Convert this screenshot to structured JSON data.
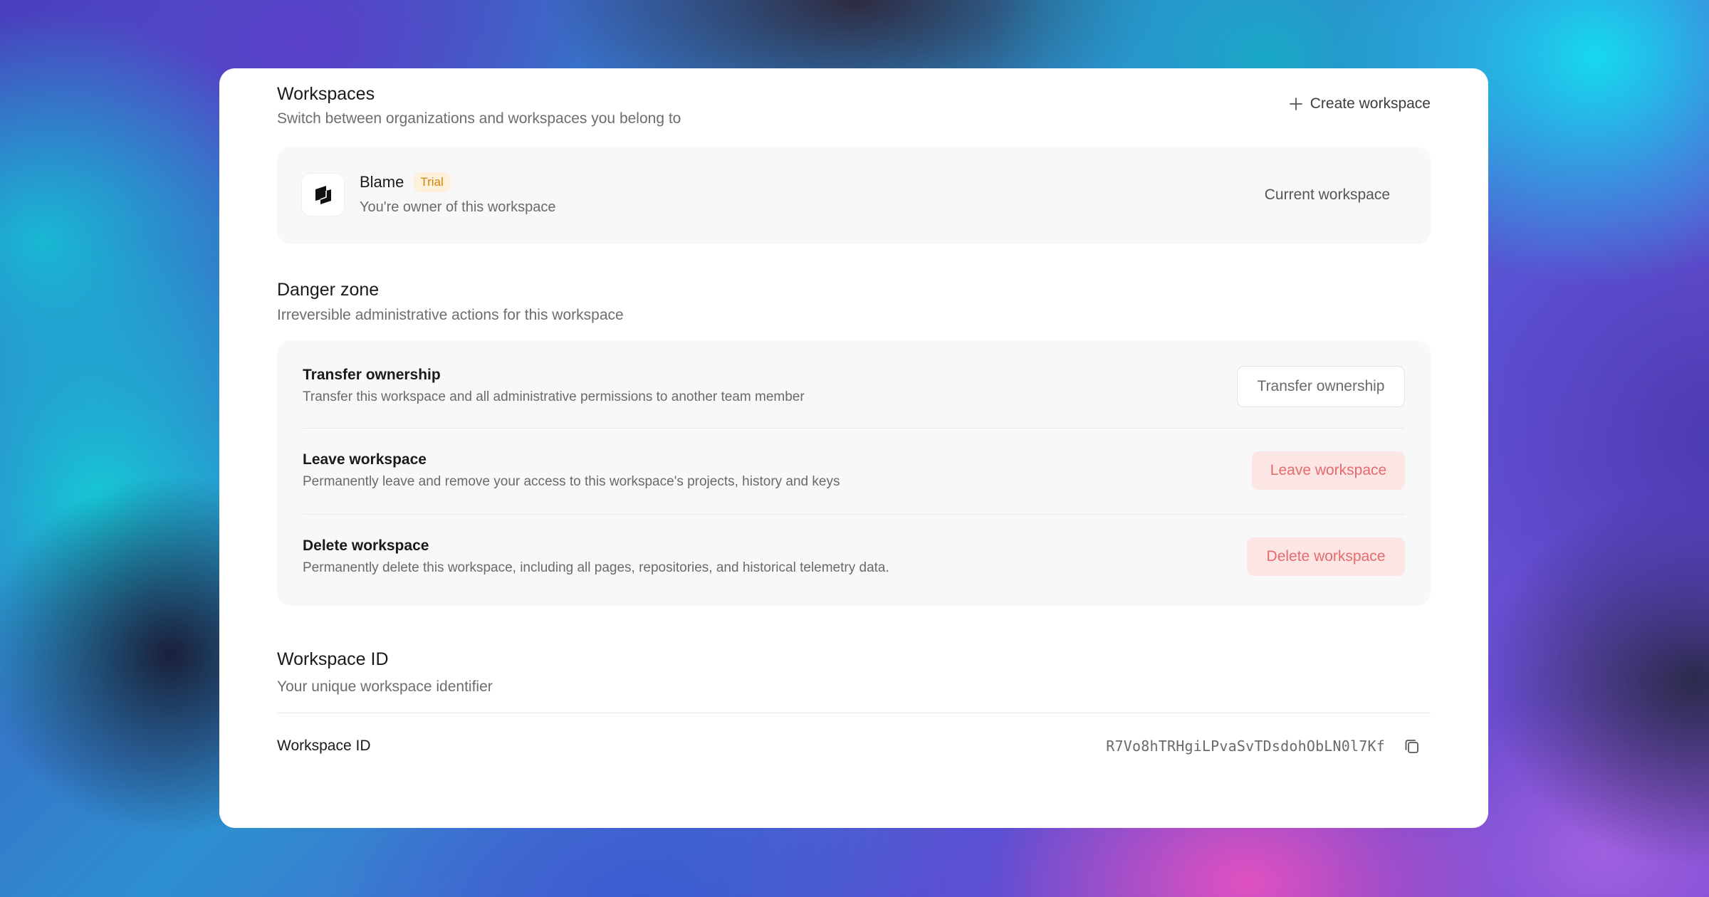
{
  "workspaces": {
    "title": "Workspaces",
    "subtitle": "Switch between organizations and workspaces you belong to",
    "create_label": "Create workspace",
    "current": {
      "name": "Blame",
      "badge": "Trial",
      "owner_text": "You're owner of this workspace",
      "status": "Current workspace"
    }
  },
  "danger_zone": {
    "title": "Danger zone",
    "subtitle": "Irreversible administrative actions for this workspace",
    "items": [
      {
        "title": "Transfer ownership",
        "description": "Transfer this workspace and all administrative permissions to another team member",
        "button": "Transfer ownership"
      },
      {
        "title": "Leave workspace",
        "description": "Permanently leave and remove your access to this workspace's projects, history and keys",
        "button": "Leave workspace"
      },
      {
        "title": "Delete workspace",
        "description": "Permanently delete this workspace, including all pages, repositories, and historical telemetry data.",
        "button": "Delete workspace"
      }
    ]
  },
  "workspace_id": {
    "title": "Workspace ID",
    "subtitle": "Your unique workspace identifier",
    "label": "Workspace ID",
    "value": "R7Vo8hTRHgiLPvaSvTDsdohObLN0l7Kf"
  },
  "colors": {
    "badge_text": "#d4830f",
    "badge_bg": "#fdf1dc",
    "danger_text": "#e86a6a",
    "danger_bg": "#fbe5e5"
  },
  "icons": [
    "plus-icon",
    "blame-logo",
    "copy-icon"
  ]
}
